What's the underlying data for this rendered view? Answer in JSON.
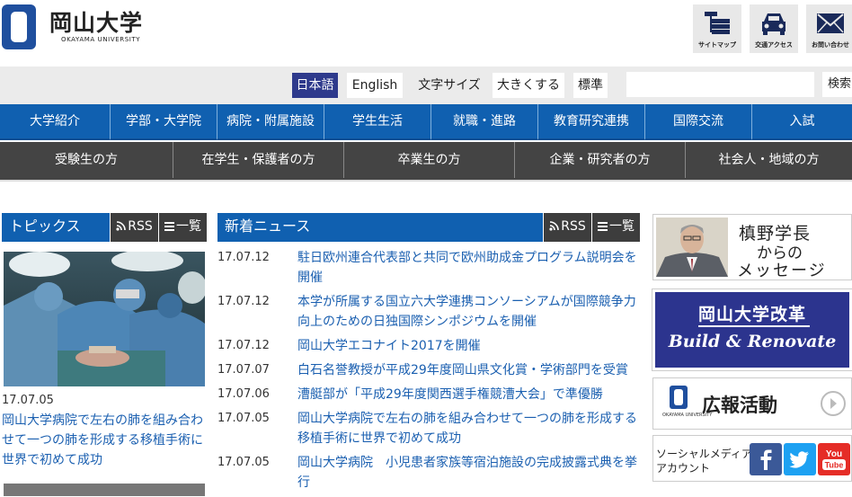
{
  "header": {
    "title": "岡山大学",
    "subtitle": "OKAYAMA UNIVERSITY",
    "icons": [
      {
        "name": "sitemap-icon",
        "label": "サイトマップ"
      },
      {
        "name": "car-icon",
        "label": "交通アクセス"
      },
      {
        "name": "mail-icon",
        "label": "お問い合わせ"
      }
    ]
  },
  "util": {
    "lang_ja": "日本語",
    "lang_en": "English",
    "font_size_label": "文字サイズ",
    "font_large": "大きくする",
    "font_normal": "標準",
    "search_placeholder": "",
    "search_button": "検索"
  },
  "gnav": [
    "大学紹介",
    "学部・大学院",
    "病院・附属施設",
    "学生生活",
    "就職・進路",
    "教育研究連携",
    "国際交流",
    "入試"
  ],
  "snav": [
    "受験生の方",
    "在学生・保護者の方",
    "卒業生の方",
    "企業・研究者の方",
    "社会人・地域の方"
  ],
  "topics": {
    "title": "トピックス",
    "rss": "RSS",
    "list": "一覧",
    "date": "17.07.05",
    "link": "岡山大学病院で左右の肺を組み合わせて一つの肺を形成する移植手術に世界で初めて成功"
  },
  "news": {
    "title": "新着ニュース",
    "rss": "RSS",
    "list": "一覧",
    "items": [
      {
        "date": "17.07.12",
        "text": "駐日欧州連合代表部と共同で欧州助成金プログラム説明会を開催"
      },
      {
        "date": "17.07.12",
        "text": "本学が所属する国立六大学連携コンソーシアムが国際競争力向上のための日独国際シンポジウムを開催"
      },
      {
        "date": "17.07.12",
        "text": "岡山大学エコナイト2017を開催"
      },
      {
        "date": "17.07.07",
        "text": "白石名誉教授が平成29年度岡山県文化賞・学術部門を受賞"
      },
      {
        "date": "17.07.06",
        "text": "漕艇部が「平成29年度関西選手権競漕大会」で準優勝"
      },
      {
        "date": "17.07.05",
        "text": "岡山大学病院で左右の肺を組み合わせて一つの肺を形成する移植手術に世界で初めて成功"
      },
      {
        "date": "17.07.05",
        "text": "岡山大学病院　小児患者家族等宿泊施設の完成披露式典を挙行"
      }
    ]
  },
  "banners": {
    "president_l1": "槙野学長",
    "president_l2": "からの",
    "president_l3": "メッセージ",
    "reform_l1": "岡山大学改革",
    "reform_l2": "Build & Renovate",
    "pr_label": "広報活動",
    "pr_mark_caption": "OKAYAMA UNIVERSITY",
    "social_label": "ソーシャルメディア\nアカウント",
    "social": [
      {
        "name": "facebook-icon",
        "glyph": "f",
        "color": "#3b5998"
      },
      {
        "name": "twitter-icon",
        "glyph": "t",
        "color": "#1da1f2"
      },
      {
        "name": "youtube-icon",
        "glyph": "You\nTube",
        "color": "#e52d27"
      }
    ]
  },
  "colors": {
    "brand_blue": "#1060b0",
    "nav_dark": "#444444",
    "link": "#1a5fb0",
    "reform_bg": "#2c348e",
    "lang_active": "#2e3a8c"
  }
}
